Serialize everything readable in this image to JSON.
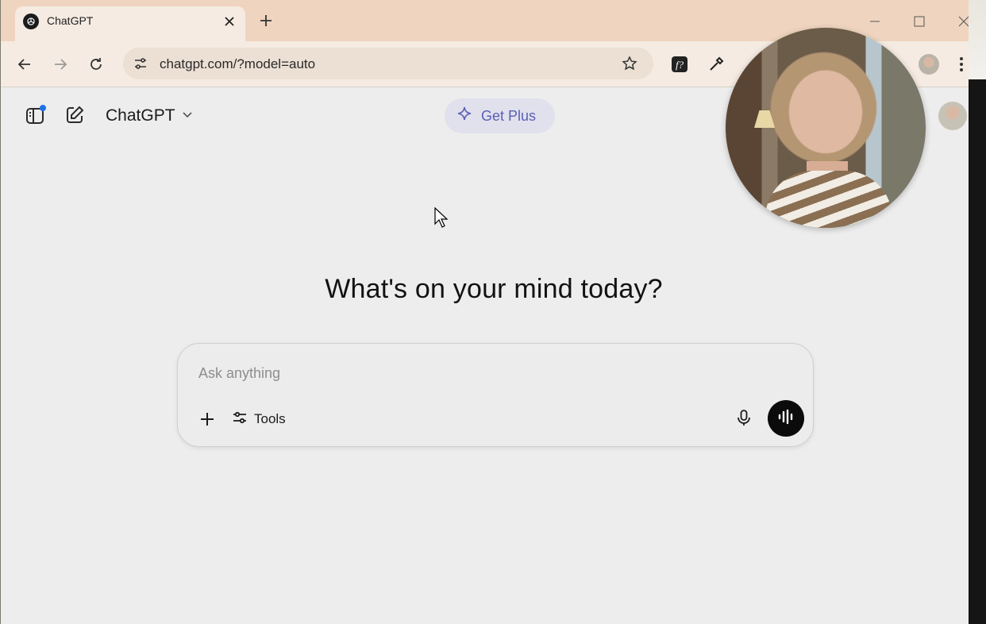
{
  "browser": {
    "tab": {
      "title": "ChatGPT"
    },
    "address_bar": {
      "url": "chatgpt.com/?model=auto"
    }
  },
  "app": {
    "model_switcher": {
      "label": "ChatGPT"
    },
    "upgrade_button": {
      "label": "Get Plus"
    },
    "headline": "What's on your mind today?",
    "composer": {
      "value": "",
      "placeholder": "Ask anything",
      "tools_label": "Tools"
    }
  },
  "colors": {
    "tab_strip": "#efd5bf",
    "toolbar": "#f6ebe2",
    "page_background": "#ededed",
    "upgrade_accent": "#5a5fb6",
    "notification_dot": "#1a73e8"
  },
  "icons": {
    "tab_favicon": "openai-logo-icon",
    "sidebar_toggle": "sidebar-icon",
    "new_chat": "new-chat-icon",
    "upgrade": "sparkle-icon",
    "attach": "plus-icon",
    "tools": "sliders-icon",
    "mic": "microphone-icon",
    "voice": "voice-waveform-icon"
  }
}
